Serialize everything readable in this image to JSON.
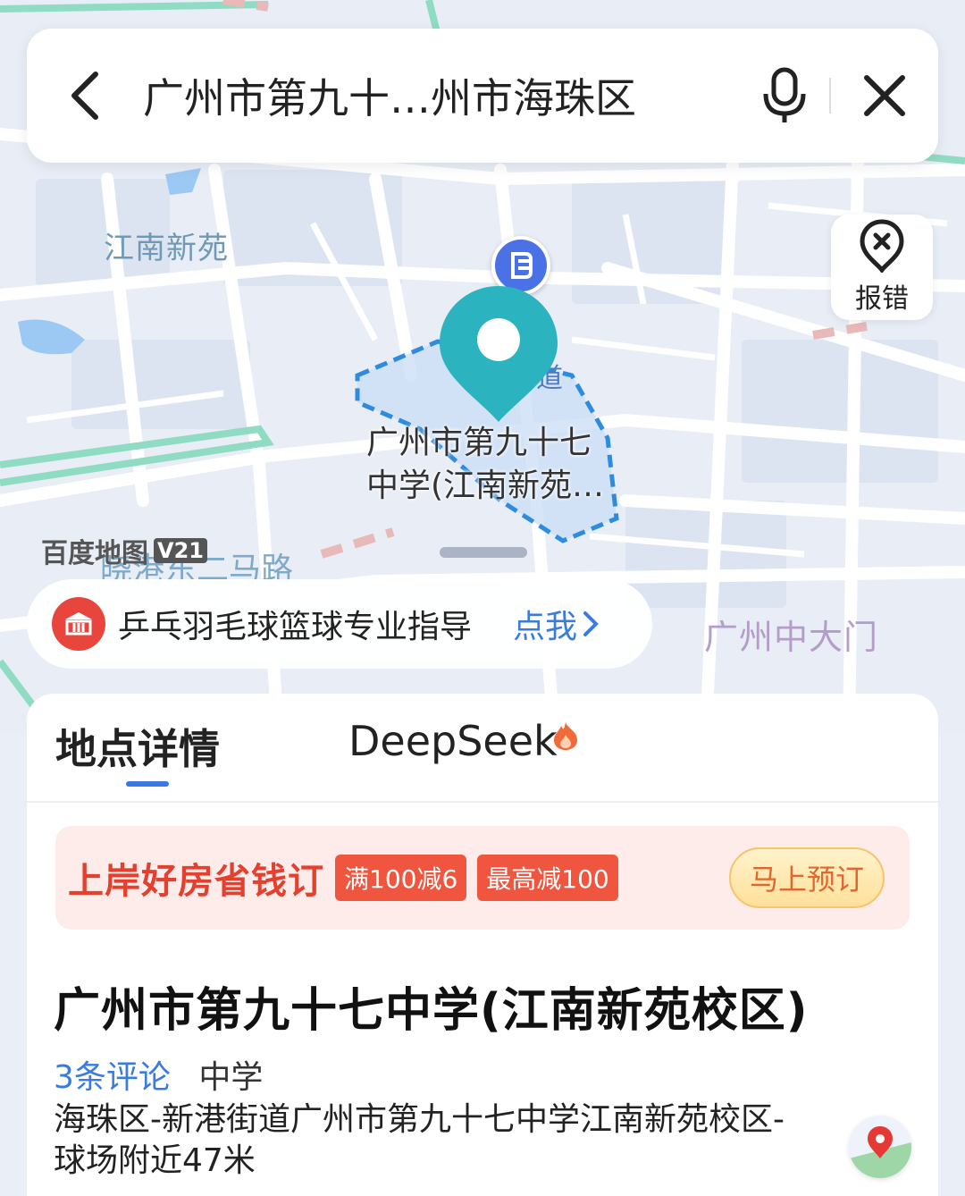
{
  "search": {
    "query": "广州市第九十…州市海珠区"
  },
  "map": {
    "labels": {
      "area_jiangnan": "江南新苑",
      "area_guangzhou_gate": "广州中大门",
      "road_xiaogang": "晓港东二马路",
      "road_partial": "道"
    },
    "poi_name_line1": "广州市第九十七",
    "poi_name_line2": "中学(江南新苑…",
    "brand": "百度地图",
    "brand_version": "V21",
    "report_label": "报错"
  },
  "promo": {
    "text": "乒乓羽毛球篮球专业指导",
    "cta": "点我"
  },
  "tabs": [
    {
      "label": "地点详情",
      "active": true
    },
    {
      "label": "DeepSeek",
      "active": false
    }
  ],
  "banner": {
    "slogan": "上岸好房省钱订",
    "tags": [
      "满100减6",
      "最高减100"
    ],
    "button": "马上预订"
  },
  "place": {
    "title": "广州市第九十七中学(江南新苑校区)",
    "reviews": "3条评论",
    "category": "中学",
    "address": "海珠区-新港街道广州市第九十七中学江南新苑校区-球场附近47米"
  },
  "colors": {
    "accent_blue": "#3a7be0",
    "pin_teal": "#2bb3c0",
    "promo_red": "#e4402f"
  }
}
